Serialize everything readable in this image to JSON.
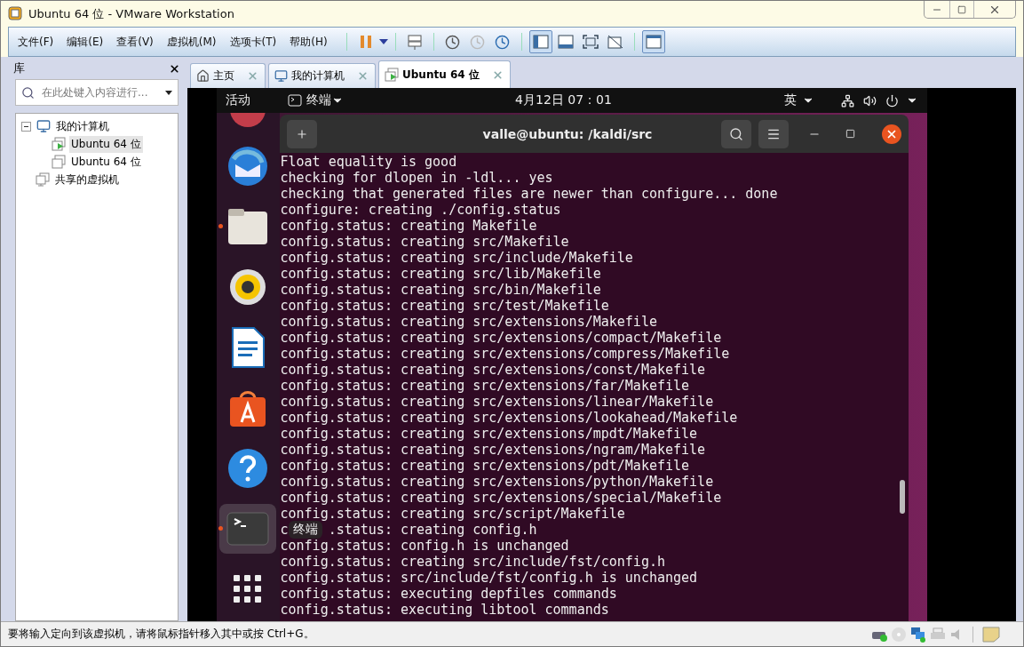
{
  "window": {
    "title": "Ubuntu 64 位 - VMware Workstation"
  },
  "menu": [
    "文件(F)",
    "编辑(E)",
    "查看(V)",
    "虚拟机(M)",
    "选项卡(T)",
    "帮助(H)"
  ],
  "view_buttons": [
    {
      "selected": true
    },
    {
      "selected": false
    },
    {
      "selected": false
    },
    {
      "selected": false
    }
  ],
  "library": {
    "title": "库",
    "search": {
      "placeholder": "在此处键入内容进行..."
    },
    "tree": [
      {
        "label": "我的计算机",
        "kind": "computer",
        "expanded": true,
        "children": [
          {
            "label": "Ubuntu 64 位",
            "kind": "vm",
            "selected": true,
            "running": true
          },
          {
            "label": "Ubuntu 64 位",
            "kind": "vm",
            "selected": false,
            "running": false
          }
        ]
      },
      {
        "label": "共享的虚拟机",
        "kind": "shared"
      }
    ]
  },
  "tabs": [
    {
      "label": "主页",
      "kind": "home",
      "selected": false
    },
    {
      "label": "我的计算机",
      "kind": "computer",
      "selected": false
    },
    {
      "label": "Ubuntu 64 位",
      "kind": "vm",
      "selected": true
    }
  ],
  "guest": {
    "activities": "活动",
    "app": "终端",
    "clock": "4月12日  07：01",
    "input_method": "英",
    "dock": [
      {
        "kind": "partial",
        "running": false,
        "selected": false
      },
      {
        "kind": "mail",
        "running": false,
        "selected": false
      },
      {
        "kind": "files",
        "running": true,
        "selected": false
      },
      {
        "kind": "music",
        "running": false,
        "selected": false
      },
      {
        "kind": "writer",
        "running": false,
        "selected": false
      },
      {
        "kind": "store",
        "running": false,
        "selected": false
      },
      {
        "kind": "help",
        "running": false,
        "selected": false
      },
      {
        "kind": "terminal",
        "running": true,
        "selected": true
      },
      {
        "kind": "apps",
        "running": false,
        "selected": false
      }
    ],
    "tooltip": "终端",
    "terminal": {
      "title": "valle@ubuntu: /kaldi/src",
      "lines": [
        {
          "text": "Float equality is good"
        },
        {
          "text": "checking for dlopen in -ldl... yes"
        },
        {
          "text": "checking that generated files are newer than configure... done"
        },
        {
          "text": "configure: creating ./config.status"
        },
        {
          "text": "config.status: creating Makefile"
        },
        {
          "text": "config.status: creating src/Makefile"
        },
        {
          "text": "config.status: creating src/include/Makefile"
        },
        {
          "text": "config.status: creating src/lib/Makefile"
        },
        {
          "text": "config.status: creating src/bin/Makefile"
        },
        {
          "text": "config.status: creating src/test/Makefile"
        },
        {
          "text": "config.status: creating src/extensions/Makefile"
        },
        {
          "text": "config.status: creating src/extensions/compact/Makefile"
        },
        {
          "text": "config.status: creating src/extensions/compress/Makefile"
        },
        {
          "text": "config.status: creating src/extensions/const/Makefile"
        },
        {
          "text": "config.status: creating src/extensions/far/Makefile"
        },
        {
          "text": "config.status: creating src/extensions/linear/Makefile"
        },
        {
          "text": "config.status: creating src/extensions/lookahead/Makefile"
        },
        {
          "text": "config.status: creating src/extensions/mpdt/Makefile"
        },
        {
          "text": "config.status: creating src/extensions/ngram/Makefile"
        },
        {
          "text": "config.status: creating src/extensions/pdt/Makefile"
        },
        {
          "text": "config.status: creating src/extensions/python/Makefile"
        },
        {
          "text": "config.status: creating src/extensions/special/Makefile"
        },
        {
          "text": "config.status: creating src/script/Makefile"
        },
        {
          "segments": [
            "c",
            ".status: creating config.h"
          ]
        },
        {
          "text": "config.status: config.h is unchanged"
        },
        {
          "text": "config.status: creating src/include/fst/config.h"
        },
        {
          "text": "config.status: src/include/fst/config.h is unchanged"
        },
        {
          "text": "config.status: executing depfiles commands"
        },
        {
          "text": "config.status: executing libtool commands"
        }
      ]
    }
  },
  "status_bar": "要将输入定向到该虚拟机，请将鼠标指针移入其中或按 Ctrl+G。"
}
